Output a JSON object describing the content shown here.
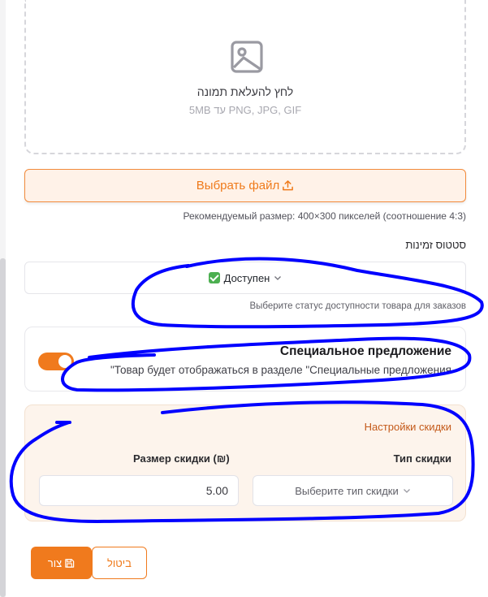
{
  "upload": {
    "title": "לחץ להעלאת תמונה",
    "hint": "5MB עד PNG, JPG, GIF",
    "icon": "image-icon"
  },
  "file_button": {
    "label": "Выбрать файл",
    "icon": "upload-icon"
  },
  "recommended_size": "Рекомендуемый размер: 400×300 пикселей (соотношение 4:3)",
  "availability": {
    "label": "סטטוס זמינות",
    "selected_value": "Доступен",
    "help": "Выберите статус доступности товара для заказов"
  },
  "special_offer": {
    "title": "Специальное предложение",
    "description": "Товар будет отображаться в разделе \"Специальные предложения\"",
    "enabled": true
  },
  "discount": {
    "heading": "Настройки скидки",
    "size_label": "Размер скидки (₪)",
    "size_value": "5.00",
    "type_label": "Тип скидки",
    "type_placeholder": "Выберите тип скидки"
  },
  "actions": {
    "save_label": "צור",
    "cancel_label": "ביטול"
  },
  "colors": {
    "accent": "#f07a1d",
    "annotation": "#0000ff",
    "available": "#4caf50"
  }
}
